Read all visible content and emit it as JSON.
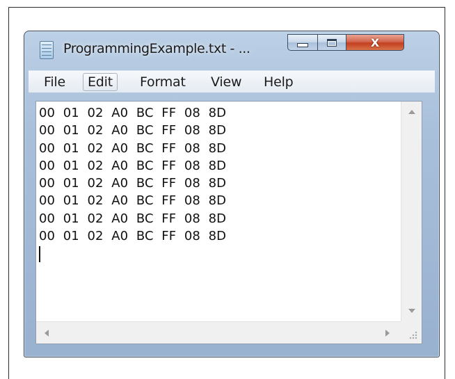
{
  "window": {
    "title": "ProgrammingExample.txt - ...",
    "icon": "notepad-icon",
    "controls": {
      "minimize": "minimize-icon",
      "maximize": "maximize-icon",
      "close_glyph": "X"
    }
  },
  "menu": {
    "items": [
      {
        "label": "File",
        "active": false
      },
      {
        "label": "Edit",
        "active": true
      },
      {
        "label": "Format",
        "active": false
      },
      {
        "label": "View",
        "active": false
      },
      {
        "label": "Help",
        "active": false
      }
    ]
  },
  "editor": {
    "lines": [
      "00  01  02  A0  BC  FF  08  8D",
      "00  01  02  A0  BC  FF  08  8D",
      "00  01  02  A0  BC  FF  08  8D",
      "00  01  02  A0  BC  FF  08  8D",
      "00  01  02  A0  BC  FF  08  8D",
      "00  01  02  A0  BC  FF  08  8D",
      "00  01  02  A0  BC  FF  08  8D",
      "00  01  02  A0  BC  FF  08  8D"
    ]
  },
  "colors": {
    "title_bar": "#a9c0db",
    "close_button": "#c2401f",
    "editor_background": "#ffffff"
  }
}
